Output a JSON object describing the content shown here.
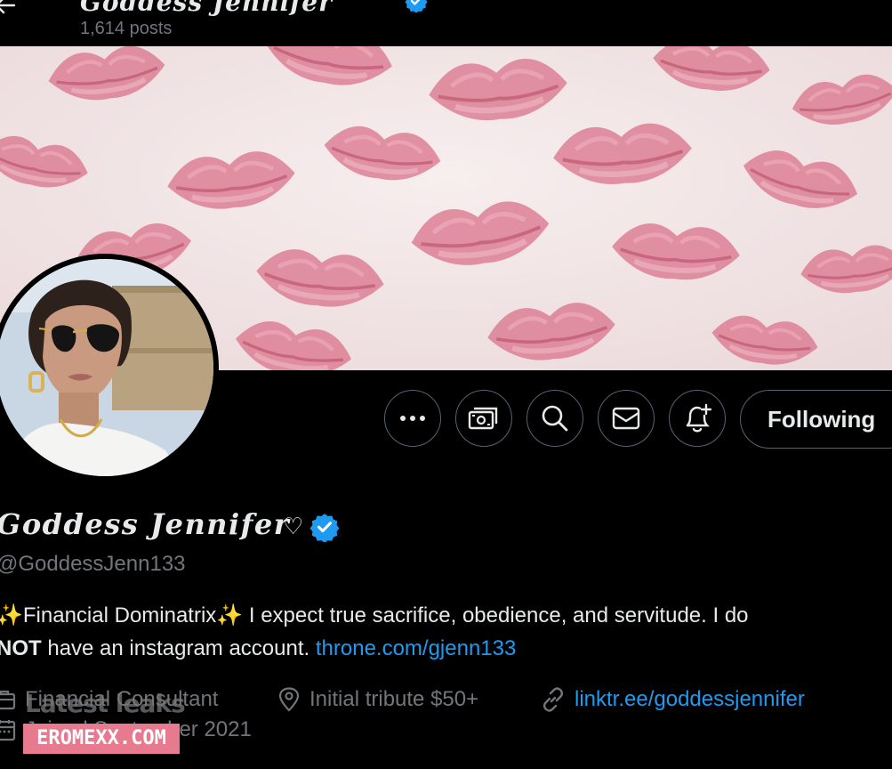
{
  "header": {
    "title": "Goddess Jennifer",
    "post_count": "1,614 posts"
  },
  "profile": {
    "display_name": "Goddess Jennifer",
    "name_suffix": "♡",
    "handle": "@GoddessJenn133",
    "bio": {
      "sparkle": "✨",
      "line1_text": "Financial Dominatrix",
      "line1_rest": " I expect true sacrifice, obedience, and servitude. I do",
      "line2_bold": "NOT",
      "line2_text": " have an instagram account. ",
      "line2_link": "throne.com/gjenn133"
    },
    "meta": {
      "category": "Financial Consultant",
      "location": "Initial tribute $50+",
      "website": "linktr.ee/goddessjennifer",
      "joined": "Joined September 2021"
    }
  },
  "actions": {
    "more_icon": "more-icon",
    "tip_icon": "tip-money-icon",
    "search_icon": "search-icon",
    "message_icon": "mail-icon",
    "notify_icon": "bell-plus-icon",
    "following_label": "Following"
  },
  "watermark": {
    "text": "Latest leaks",
    "badge": "EROMEXX.COM"
  },
  "colors": {
    "background": "#000000",
    "text": "#e7e9ea",
    "muted": "#71767b",
    "link": "#1d9bf0",
    "verified": "#1d9bf0",
    "banner_bg": "#f3e9ea",
    "lip_color": "#d9728a"
  }
}
